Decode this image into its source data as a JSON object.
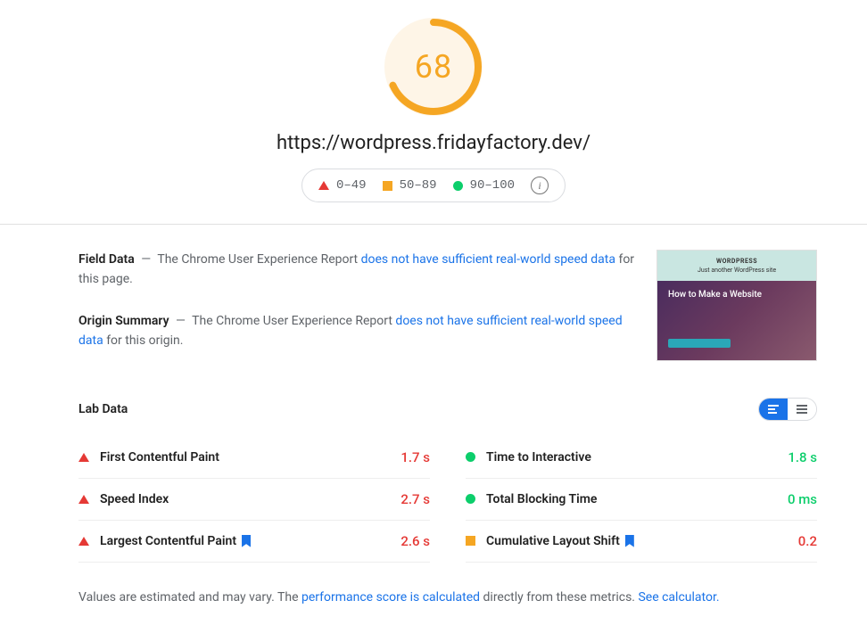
{
  "score": {
    "value": 68,
    "color": "#f5a623",
    "percent": 68
  },
  "url": "https://wordpress.fridayfactory.dev/",
  "legend": {
    "red": "0–49",
    "orange": "50–89",
    "green": "90–100"
  },
  "fieldData": {
    "title": "Field Data",
    "pre": "The Chrome User Experience Report ",
    "link": "does not have sufficient real-world speed data",
    "post": " for this page."
  },
  "originSummary": {
    "title": "Origin Summary",
    "pre": "The Chrome User Experience Report ",
    "link": "does not have sufficient real-world speed data",
    "post": " for this origin."
  },
  "thumbnail": {
    "logo": "WORDPRESS",
    "tagline": "Just another WordPress site",
    "heroTitle": "How to Make a Website"
  },
  "labData": {
    "title": "Lab Data",
    "metrics": [
      {
        "name": "First Contentful Paint",
        "value": "1.7 s",
        "status": "red",
        "bookmark": false
      },
      {
        "name": "Time to Interactive",
        "value": "1.8 s",
        "status": "green",
        "bookmark": false
      },
      {
        "name": "Speed Index",
        "value": "2.7 s",
        "status": "red",
        "bookmark": false
      },
      {
        "name": "Total Blocking Time",
        "value": "0 ms",
        "status": "green",
        "bookmark": false
      },
      {
        "name": "Largest Contentful Paint",
        "value": "2.6 s",
        "status": "red",
        "bookmark": true
      },
      {
        "name": "Cumulative Layout Shift",
        "value": "0.2",
        "status": "orange-red",
        "bookmark": true
      }
    ]
  },
  "footnote": {
    "pre": "Values are estimated and may vary. The ",
    "link1": "performance score is calculated",
    "mid": " directly from these metrics. ",
    "link2": "See calculator."
  }
}
